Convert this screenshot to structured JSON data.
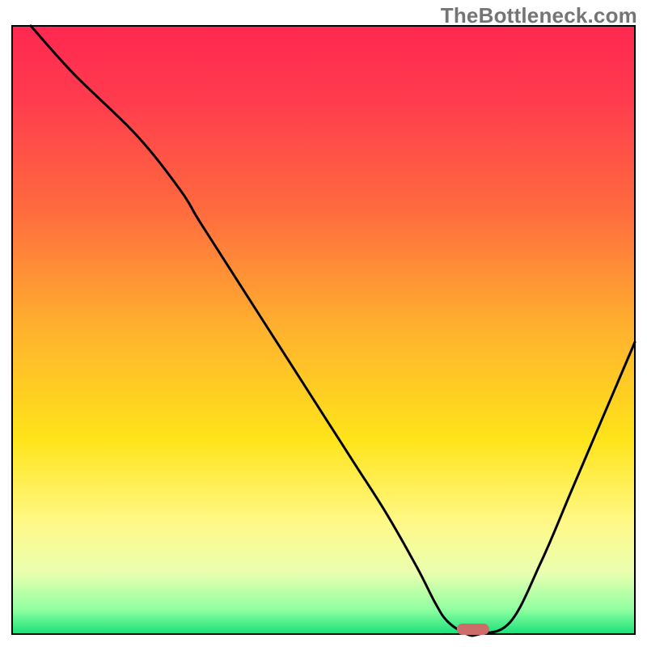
{
  "watermark": "TheBottleneck.com",
  "chart_data": {
    "type": "line",
    "title": "",
    "xlabel": "",
    "ylabel": "",
    "xlim": [
      0,
      100
    ],
    "ylim": [
      0,
      100
    ],
    "grid": false,
    "legend": false,
    "x": [
      3,
      10,
      20,
      27,
      30,
      35,
      40,
      45,
      50,
      55,
      60,
      65,
      68,
      70,
      73,
      75,
      80,
      85,
      90,
      95,
      100
    ],
    "y": [
      100,
      92,
      82,
      73,
      68,
      60,
      52,
      44,
      36,
      28,
      20,
      11,
      5,
      2,
      0,
      0,
      2,
      12,
      24,
      36,
      48
    ],
    "notes": "Curve shows bottleneck mismatch percentage (y) across component balance (x). Minimum (~0%) occurs around x=73–77; a small highlighted marker sits at the trough. Background is a vertical heat gradient from green (low y, good match) through yellow/orange to red (high y, severe bottleneck).",
    "background_gradient_stops": [
      {
        "offset": 0.0,
        "color": "#ff2850"
      },
      {
        "offset": 0.12,
        "color": "#ff3b4e"
      },
      {
        "offset": 0.3,
        "color": "#ff6a3f"
      },
      {
        "offset": 0.5,
        "color": "#ffb22e"
      },
      {
        "offset": 0.68,
        "color": "#ffe41a"
      },
      {
        "offset": 0.82,
        "color": "#fff98a"
      },
      {
        "offset": 0.9,
        "color": "#e8ffb0"
      },
      {
        "offset": 0.96,
        "color": "#8fffa0"
      },
      {
        "offset": 1.0,
        "color": "#18e07a"
      }
    ],
    "marker": {
      "x": 74,
      "y": 0,
      "color": "#cc6d6a",
      "rx": 20,
      "ry": 7
    }
  }
}
